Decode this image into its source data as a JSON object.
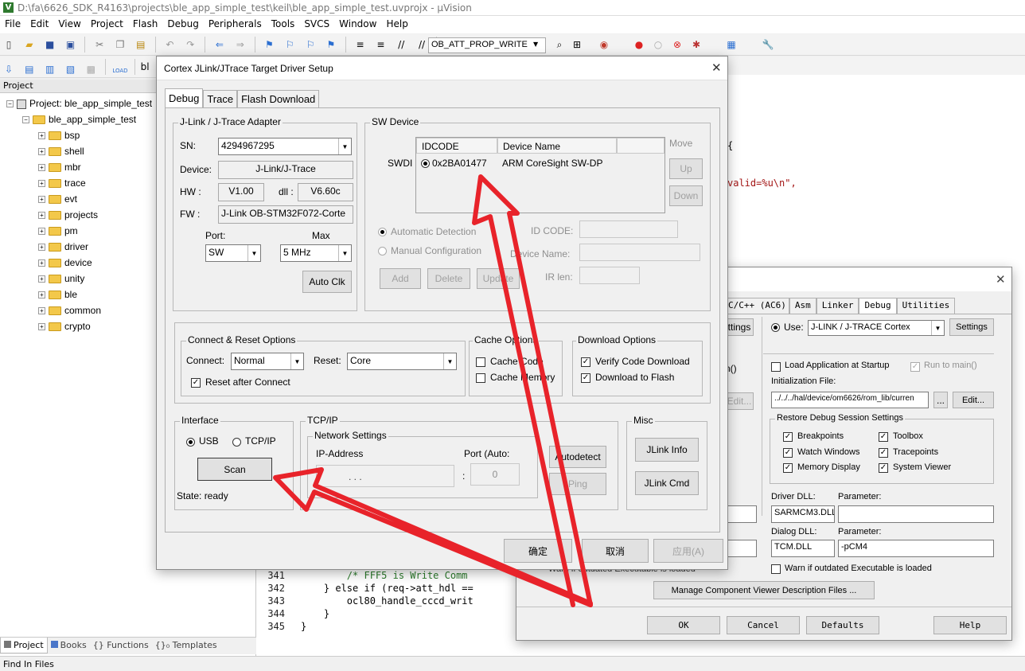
{
  "window": {
    "title": "D:\\fa\\6626_SDK_R4163\\projects\\ble_app_simple_test\\keil\\ble_app_simple_test.uvprojx - µVision"
  },
  "menu": [
    "File",
    "Edit",
    "View",
    "Project",
    "Flash",
    "Debug",
    "Peripherals",
    "Tools",
    "SVCS",
    "Window",
    "Help"
  ],
  "toolbar": {
    "target_combo": "OB_ATT_PROP_WRITE",
    "build_target_partial": "bl"
  },
  "project": {
    "header": "Project",
    "root": "Project: ble_app_simple_test",
    "target": "ble_app_simple_test",
    "groups": [
      "bsp",
      "shell",
      "mbr",
      "trace",
      "evt",
      "projects",
      "pm",
      "driver",
      "device",
      "unity",
      "ble",
      "common",
      "crypto"
    ]
  },
  "bottom_tabs": [
    "Project",
    "Books",
    "{} Functions",
    "{}₀ Templates"
  ],
  "status_bar": "Find In Files",
  "editor": {
    "right_fragments": [
      "{",
      "valid=%u\\n\","
    ],
    "lines": [
      {
        "n": "341",
        "code": "        /* FFF5 is Write Comm"
      },
      {
        "n": "342",
        "code": "    } else if (req->att_hdl =="
      },
      {
        "n": "343",
        "code": "        ocl80_handle_cccd_writ"
      },
      {
        "n": "344",
        "code": "    }"
      },
      {
        "n": "345",
        "code": "}"
      }
    ]
  },
  "jlink": {
    "title": "Cortex JLink/JTrace Target Driver Setup",
    "close": "✕",
    "tabs": [
      "Debug",
      "Trace",
      "Flash Download"
    ],
    "adapter": {
      "group": "J-Link / J-Trace Adapter",
      "sn_label": "SN:",
      "sn": "4294967295",
      "device_label": "Device:",
      "device": "J-Link/J-Trace",
      "hw_label": "HW :",
      "hw": "V1.00",
      "dll_label": "dll :",
      "dll": "V6.60c",
      "fw_label": "FW :",
      "fw": "J-Link OB-STM32F072-Corte",
      "port_label": "Port:",
      "port": "SW",
      "max_label": "Max",
      "max": "5 MHz",
      "auto_clk": "Auto Clk"
    },
    "sw_device": {
      "group": "SW Device",
      "swdi": "SWDI",
      "col_idcode": "IDCODE",
      "col_name": "Device Name",
      "row_idcode": "0x2BA01477",
      "row_name": "ARM CoreSight SW-DP",
      "move": "Move",
      "up": "Up",
      "down": "Down",
      "auto_detect": "Automatic Detection",
      "manual_config": "Manual Configuration",
      "id_code_label": "ID CODE:",
      "device_name_label": "Device Name:",
      "ir_len_label": "IR len:",
      "add": "Add",
      "delete": "Delete",
      "update": "Update"
    },
    "connect": {
      "group": "Connect & Reset Options",
      "connect_label": "Connect:",
      "connect_value": "Normal",
      "reset_label": "Reset:",
      "reset_value": "Core",
      "reset_after_connect": "Reset after Connect"
    },
    "cache": {
      "group": "Cache Options",
      "code": "Cache Code",
      "memory": "Cache Memory"
    },
    "download": {
      "group": "Download Options",
      "verify": "Verify Code Download",
      "flash": "Download to Flash"
    },
    "interface": {
      "group": "Interface",
      "usb": "USB",
      "tcpip": "TCP/IP",
      "scan": "Scan",
      "state": "State: ready"
    },
    "tcpip": {
      "group": "TCP/IP",
      "net_group": "Network Settings",
      "ip_label": "IP-Address",
      "port_label": "Port (Auto:",
      "ip_dots": ".       .       .",
      "port_value": "0",
      "colon": ":",
      "autodetect": "Autodetect",
      "ping": "Ping"
    },
    "misc": {
      "group": "Misc",
      "info": "JLink Info",
      "cmd": "JLink Cmd"
    },
    "ok": "确定",
    "cancel": "取消",
    "apply": "应用(A)"
  },
  "options": {
    "close": "✕",
    "tabs": [
      "C/C++ (AC6)",
      "Asm",
      "Linker",
      "Debug",
      "Utilities"
    ],
    "left_settings": "ttings",
    "left_n": "n()",
    "left_edit": "Edit...",
    "use_label": "Use:",
    "use_value": "J-LINK / J-TRACE Cortex",
    "settings": "Settings",
    "load_app": "Load Application at Startup",
    "run_to_main": "Run to main()",
    "init_file_label": "Initialization File:",
    "init_file": "../../../hal/device/om6626/rom_lib/curren",
    "browse": "...",
    "edit": "Edit...",
    "restore_group": "Restore Debug Session Settings",
    "breakpoints": "Breakpoints",
    "toolbox": "Toolbox",
    "watch": "Watch Windows",
    "tracepoints": "Tracepoints",
    "memory": "Memory Display",
    "sysviewer": "System Viewer",
    "driver_dll_label": "Driver DLL:",
    "driver_dll": "SARMCM3.DLL",
    "param_label": "Parameter:",
    "driver_param": "",
    "dialog_dll_label": "Dialog DLL:",
    "dialog_dll": "TCM.DLL",
    "dialog_param": "-pCM4",
    "warn_outdated": "Warn if outdated Executable is loaded",
    "warn_outdated_left": "Warn if outdated Executable is loaded",
    "manage": "Manage Component Viewer Description Files ...",
    "ok": "OK",
    "cancel": "Cancel",
    "defaults": "Defaults",
    "help": "Help"
  }
}
